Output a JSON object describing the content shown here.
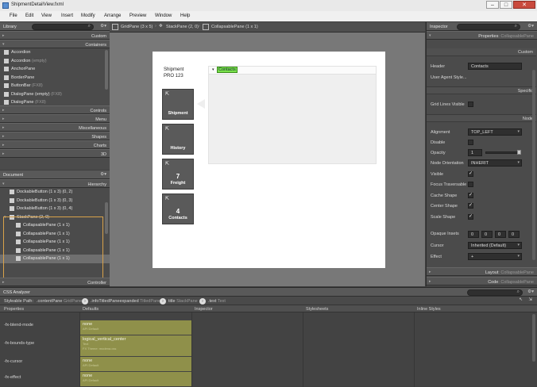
{
  "window": {
    "title": "ShipmentDetailView.fxml",
    "min": "–",
    "max": "□",
    "close": "✕"
  },
  "menu": [
    "File",
    "Edit",
    "View",
    "Insert",
    "Modify",
    "Arrange",
    "Preview",
    "Window",
    "Help"
  ],
  "library": {
    "title": "Library",
    "sections_top": [
      {
        "label": "Custom"
      },
      {
        "label": "Containers"
      }
    ],
    "items": [
      {
        "label": "Accordion",
        "note": ""
      },
      {
        "label": "Accordion",
        "note": "(empty)"
      },
      {
        "label": "AnchorPane",
        "note": ""
      },
      {
        "label": "BorderPane",
        "note": ""
      },
      {
        "label": "ButtonBar",
        "note": "(FX8)"
      },
      {
        "label": "DialogPane (empty)",
        "note": "(FX8)"
      },
      {
        "label": "DialogPane",
        "note": "(FX8)"
      }
    ],
    "sections_bottom": [
      {
        "label": "Controls"
      },
      {
        "label": "Menu"
      },
      {
        "label": "Miscellaneous"
      },
      {
        "label": "Shapes"
      },
      {
        "label": "Charts"
      },
      {
        "label": "3D"
      }
    ]
  },
  "document": {
    "title": "Document",
    "hierarchy_label": "Hierarchy",
    "items": [
      {
        "label": "DockableButton (1 x 3) (0, 2)",
        "indent": 1,
        "selected": false,
        "icon": "dockable-icon"
      },
      {
        "label": "DockableButton (1 x 3) (0, 3)",
        "indent": 1,
        "selected": false,
        "icon": "dockable-icon"
      },
      {
        "label": "DockableButton (1 x 3) (0, 4)",
        "indent": 1,
        "selected": false,
        "icon": "dockable-icon"
      },
      {
        "label": "StackPane (2, 0)",
        "indent": 1,
        "selected": false,
        "icon": "stackpane-icon",
        "expander": "▾"
      },
      {
        "label": "CollapsablePane (1 x 1)",
        "indent": 2,
        "selected": false,
        "icon": "collapsable-icon"
      },
      {
        "label": "CollapsablePane (1 x 1)",
        "indent": 2,
        "selected": false,
        "icon": "collapsable-icon"
      },
      {
        "label": "CollapsablePane (1 x 1)",
        "indent": 2,
        "selected": false,
        "icon": "collapsable-icon"
      },
      {
        "label": "CollapsablePane (1 x 1)",
        "indent": 2,
        "selected": false,
        "icon": "collapsable-icon"
      },
      {
        "label": "CollapsablePane (1 x 1)",
        "indent": 2,
        "selected": true,
        "icon": "collapsable-icon"
      }
    ],
    "controller_label": "Controller"
  },
  "breadcrumb": [
    {
      "label": "GridPane (3 x 5)",
      "icon": "gridpane-icon"
    },
    {
      "label": "StackPane (2, 0)",
      "icon": "stackpane-icon"
    },
    {
      "label": "CollapsablePane (1 x 1)",
      "icon": "collapsable-icon"
    }
  ],
  "canvas": {
    "heading_line1": "Shipment",
    "heading_line2": "PRO 123",
    "contacts_toggle": "▾",
    "contacts_label": "Contacts",
    "buttons": [
      {
        "number": "",
        "label": "Shipment"
      },
      {
        "number": "",
        "label": "History"
      },
      {
        "number": "7",
        "label": "Freight"
      },
      {
        "number": "4",
        "label": "Contacts"
      }
    ],
    "corner_glyph": "⇱"
  },
  "inspector": {
    "title": "Inspector",
    "properties_label": "Properties",
    "properties_type": ": CollapsablePane",
    "custom_label": "Custom",
    "header_key": "Header",
    "header_value": "Contacts",
    "user_agent_key": "User Agent Style...",
    "specific_label": "Specific",
    "grid_lines_key": "Grid Lines Visible",
    "node_label": "Node",
    "alignment_key": "Alignment",
    "alignment_value": "TOP_LEFT",
    "disable_key": "Disable",
    "opacity_key": "Opacity",
    "opacity_value": "1",
    "node_orientation_key": "Node Orientation",
    "node_orientation_value": "INHERIT",
    "visible_key": "Visible",
    "focus_key": "Focus Traversable",
    "cache_key": "Cache Shape",
    "center_key": "Center Shape",
    "scale_key": "Scale Shape",
    "opaque_key": "Opaque Insets",
    "opaque_values": [
      "0",
      "0",
      "0",
      "0"
    ],
    "cursor_key": "Cursor",
    "cursor_value": "Inherited (Default)",
    "effect_key": "Effect",
    "effect_value": "+",
    "layout_label": "Layout",
    "layout_type": ": CollapsablePane",
    "code_label": "Code",
    "code_type": ": CollapsablePane",
    "checks": {
      "grid_lines": false,
      "disable": false,
      "visible": true,
      "focus": false,
      "cache": true,
      "center": true,
      "scale": true
    }
  },
  "css": {
    "title": "CSS Analyzer",
    "path_label": "Styleable Path:",
    "path": [
      {
        "label": ".contentPane",
        "type": "GridPane"
      },
      {
        "label": ".infoTitledPaneexpanded",
        "type": "TitledPane"
      },
      {
        "label": "title",
        "type": "StackPane"
      },
      {
        "label": ".text",
        "type": "Text"
      }
    ],
    "columns": [
      "Properties",
      "Defaults",
      "Inspector",
      "Stylesheets",
      "Inline Styles"
    ],
    "rows": [
      {
        "prop": "-fx-blend-mode",
        "value": "none",
        "source": "API Default",
        "source2": ""
      },
      {
        "prop": "-fx-bounds-type",
        "value": "logical_vertical_center",
        "source": "Text",
        "source2": "FX Theme: modena.css"
      },
      {
        "prop": "-fx-cursor",
        "value": "none",
        "source": "API Default",
        "source2": ""
      },
      {
        "prop": "-fx-effect",
        "value": "none",
        "source": "API Default",
        "source2": ""
      }
    ]
  },
  "colors": {
    "accent_green": "#78e04a",
    "olive": "#8f904a",
    "selection_orange": "#d9a24a"
  }
}
